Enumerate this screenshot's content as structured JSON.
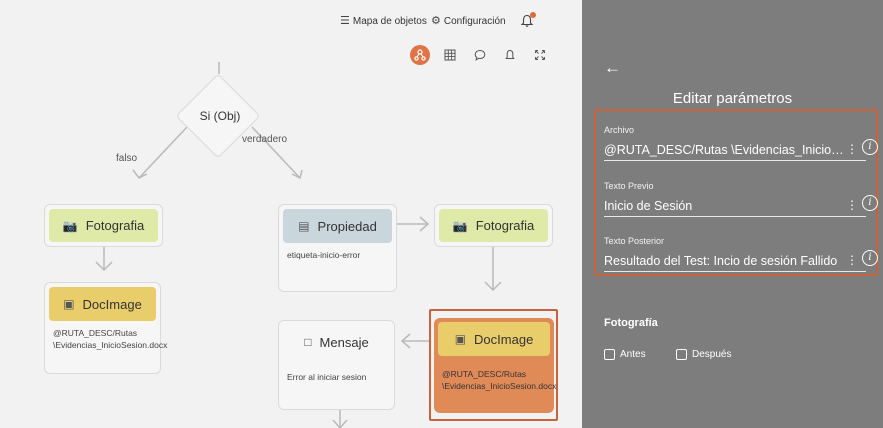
{
  "topbar": {
    "object_map_label": "Mapa de objetos",
    "settings_label": "Configuración"
  },
  "flow": {
    "decision_label": "Si (Obj)",
    "edge_false": "falso",
    "edge_true": "verdadero",
    "nodes": {
      "foto1": {
        "title": "Fotografia"
      },
      "doc1": {
        "title": "DocImage",
        "text": "@RUTA_DESC/Rutas \\Evidencias_InicioSesion.docx"
      },
      "prop": {
        "title": "Propiedad",
        "text": "etiqueta-inicio-error"
      },
      "foto2": {
        "title": "Fotografia"
      },
      "msg": {
        "title": "Mensaje",
        "text": "Error al iniciar sesion"
      },
      "doc2": {
        "title": "DocImage",
        "text": "@RUTA_DESC/Rutas \\Evidencias_InicioSesion.docx"
      }
    }
  },
  "panel": {
    "title": "Editar parámetros",
    "fields": [
      {
        "label": "Archivo",
        "value": "@RUTA_DESC/Rutas \\Evidencias_InicioSesion.docx"
      },
      {
        "label": "Texto Previo",
        "value": "Inicio de Sesión"
      },
      {
        "label": "Texto Posterior",
        "value": "Resultado del Test: Incio de sesión Fallido"
      }
    ],
    "photo_section": "Fotografía",
    "before_label": "Antes",
    "after_label": "Después"
  },
  "colors": {
    "accent": "#c8623a",
    "panel_bg": "#7d7d7d",
    "green_head": "#dfe9a8",
    "blue_head": "#c9d6db",
    "yellow_head": "#e9cd6a",
    "selected_node": "#e08a57"
  }
}
